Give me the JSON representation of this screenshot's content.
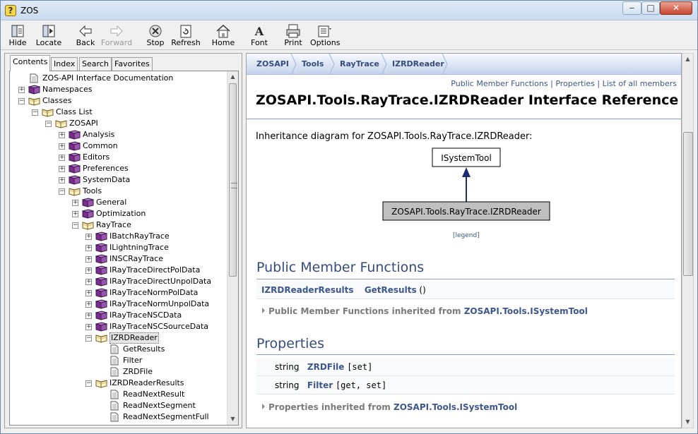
{
  "window": {
    "title": "ZOS",
    "min": "‒",
    "max": "□",
    "close": "✕"
  },
  "toolbar": [
    {
      "id": "hide",
      "label": "Hide",
      "icon": "hide-icon",
      "disabled": false
    },
    {
      "id": "locate",
      "label": "Locate",
      "icon": "locate-icon",
      "disabled": false
    },
    {
      "id": "back",
      "label": "Back",
      "icon": "back-arrow-icon",
      "disabled": false
    },
    {
      "id": "forward",
      "label": "Forward",
      "icon": "forward-arrow-icon",
      "disabled": true
    },
    {
      "id": "stop",
      "label": "Stop",
      "icon": "stop-icon",
      "disabled": false
    },
    {
      "id": "refresh",
      "label": "Refresh",
      "icon": "refresh-icon",
      "disabled": false
    },
    {
      "id": "home",
      "label": "Home",
      "icon": "home-icon",
      "disabled": false
    },
    {
      "id": "font",
      "label": "Font",
      "icon": "font-icon",
      "disabled": false
    },
    {
      "id": "print",
      "label": "Print",
      "icon": "print-icon",
      "disabled": false
    },
    {
      "id": "options",
      "label": "Options",
      "icon": "options-icon",
      "disabled": false
    }
  ],
  "tabs": [
    {
      "label": "Contents",
      "active": true
    },
    {
      "label": "Index",
      "active": false
    },
    {
      "label": "Search",
      "active": false
    },
    {
      "label": "Favorites",
      "active": false
    }
  ],
  "tree": [
    {
      "label": "ZOS-API Interface Documentation",
      "level": 0,
      "icon": "page",
      "expander": ""
    },
    {
      "label": "Namespaces",
      "level": 0,
      "icon": "book",
      "expander": "+"
    },
    {
      "label": "Classes",
      "level": 0,
      "icon": "openbook",
      "expander": "−"
    },
    {
      "label": "Class List",
      "level": 1,
      "icon": "openbook",
      "expander": "−"
    },
    {
      "label": "ZOSAPI",
      "level": 2,
      "icon": "openbook",
      "expander": "−"
    },
    {
      "label": "Analysis",
      "level": 3,
      "icon": "book",
      "expander": "+"
    },
    {
      "label": "Common",
      "level": 3,
      "icon": "book",
      "expander": "+"
    },
    {
      "label": "Editors",
      "level": 3,
      "icon": "book",
      "expander": "+"
    },
    {
      "label": "Preferences",
      "level": 3,
      "icon": "book",
      "expander": "+"
    },
    {
      "label": "SystemData",
      "level": 3,
      "icon": "book",
      "expander": "+"
    },
    {
      "label": "Tools",
      "level": 3,
      "icon": "openbook",
      "expander": "−"
    },
    {
      "label": "General",
      "level": 4,
      "icon": "book",
      "expander": "+"
    },
    {
      "label": "Optimization",
      "level": 4,
      "icon": "book",
      "expander": "+"
    },
    {
      "label": "RayTrace",
      "level": 4,
      "icon": "openbook",
      "expander": "−"
    },
    {
      "label": "IBatchRayTrace",
      "level": 5,
      "icon": "book",
      "expander": "+"
    },
    {
      "label": "ILightningTrace",
      "level": 5,
      "icon": "book",
      "expander": "+"
    },
    {
      "label": "INSCRayTrace",
      "level": 5,
      "icon": "book",
      "expander": "+"
    },
    {
      "label": "IRayTraceDirectPolData",
      "level": 5,
      "icon": "book",
      "expander": "+"
    },
    {
      "label": "IRayTraceDirectUnpolData",
      "level": 5,
      "icon": "book",
      "expander": "+"
    },
    {
      "label": "IRayTraceNormPolData",
      "level": 5,
      "icon": "book",
      "expander": "+"
    },
    {
      "label": "IRayTraceNormUnpolData",
      "level": 5,
      "icon": "book",
      "expander": "+"
    },
    {
      "label": "IRayTraceNSCData",
      "level": 5,
      "icon": "book",
      "expander": "+"
    },
    {
      "label": "IRayTraceNSCSourceData",
      "level": 5,
      "icon": "book",
      "expander": "+"
    },
    {
      "label": "IZRDReader",
      "level": 5,
      "icon": "openbook",
      "expander": "−",
      "selected": true
    },
    {
      "label": "GetResults",
      "level": 6,
      "icon": "page",
      "expander": ""
    },
    {
      "label": "Filter",
      "level": 6,
      "icon": "page",
      "expander": ""
    },
    {
      "label": "ZRDFile",
      "level": 6,
      "icon": "page",
      "expander": ""
    },
    {
      "label": "IZRDReaderResults",
      "level": 5,
      "icon": "openbook",
      "expander": "−"
    },
    {
      "label": "ReadNextResult",
      "level": 6,
      "icon": "page",
      "expander": ""
    },
    {
      "label": "ReadNextSegment",
      "level": 6,
      "icon": "page",
      "expander": ""
    },
    {
      "label": "ReadNextSegmentFull",
      "level": 6,
      "icon": "page",
      "expander": ""
    }
  ],
  "breadcrumb": [
    "ZOSAPI",
    "Tools",
    "RayTrace",
    "IZRDReader"
  ],
  "header_links": [
    "Public Member Functions",
    "Properties",
    "List of all members"
  ],
  "header_link_sep": " | ",
  "page_title": "ZOSAPI.Tools.RayTrace.IZRDReader Interface Reference",
  "inheritance_text": "Inheritance diagram for ZOSAPI.Tools.RayTrace.IZRDReader:",
  "diagram": {
    "parent": "ISystemTool",
    "child": "ZOSAPI.Tools.RayTrace.IZRDReader",
    "legend": "[legend]"
  },
  "pmf": {
    "heading": "Public Member Functions",
    "rows": [
      {
        "type": "IZRDReaderResults",
        "name": "GetResults",
        "args": " ()"
      }
    ],
    "inherited_prefix": "Public Member Functions inherited from ",
    "inherited_link": "ZOSAPI.Tools.ISystemTool"
  },
  "props": {
    "heading": "Properties",
    "rows": [
      {
        "type": "string",
        "name": "ZRDFile",
        "access": "[set]"
      },
      {
        "type": "string",
        "name": "Filter",
        "access": "[get, set]"
      }
    ],
    "inherited_prefix": "Properties inherited from ",
    "inherited_link": "ZOSAPI.Tools.ISystemTool"
  },
  "colors": {
    "link": "#3d578c",
    "book": "#7b2d8e",
    "accent": "#354c7b"
  }
}
